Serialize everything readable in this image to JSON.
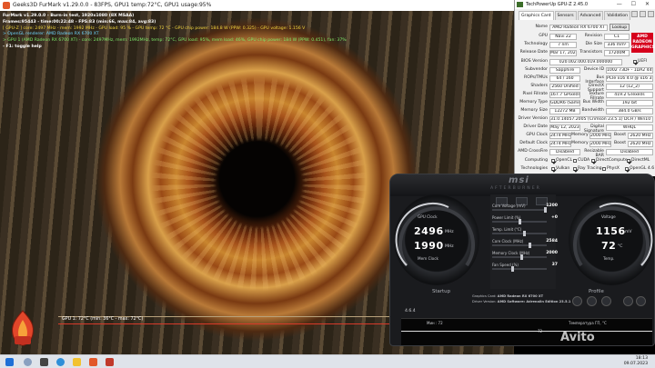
{
  "furmark": {
    "title": "Geeks3D FurMark v1.29.0.0 - 83FPS, GPU1 temp:72°C, GPU1 usage:95%",
    "info": [
      {
        "text": "FurMark v1.29.0.0 - Burn-in test, 1920x1080 (8X MSAA)",
        "style": "white"
      },
      {
        "text": "Frames:95443 - time:00:22:48 - FPS:83 (min:66, max:84, avg:83)",
        "style": "white"
      },
      {
        "text": "[ GPU-Z ] core: 2497 MHz - mem: 1992 MHz - GPU load: 95 % - GPU temp: 72 °C - GPU chip power: 184.8 W (PPW: 0.325) - GPU voltage: 1.156 V",
        "style": "yellow"
      },
      {
        "text": "> OpenGL renderer: AMD Radeon RX 6700 XT",
        "style": "cyan"
      },
      {
        "text": "> GPU 1 (AMD Radeon RX 6700 XT) - core: 2497MHz, mem: 1992MHz, temp: 72°C, GPU load: 95%, mem load: 46%, GPU chip power: 184 W (PPW: 0.451), fan: 37%",
        "style": "green"
      },
      {
        "text": "- F1: toggle help",
        "style": "white"
      }
    ],
    "graph_label": "GPU 1: 72°C (min: 36°C - max: 72°C)"
  },
  "gpuz": {
    "title": "TechPowerUp GPU-Z 2.45.0",
    "tabs": [
      "Graphics Card",
      "Sensors",
      "Advanced",
      "Validation"
    ],
    "rows": {
      "name": {
        "label": "Name",
        "value": "AMD Radeon RX 6700 XT"
      },
      "gpu": {
        "label": "GPU",
        "value": "Navi 22"
      },
      "revision": {
        "label": "Revision",
        "value": "C1"
      },
      "technology": {
        "label": "Technology",
        "value": "7 nm"
      },
      "die_size": {
        "label": "Die Size",
        "value": "336 mm²"
      },
      "release_date": {
        "label": "Release Date",
        "value": "Mar 17, 2021"
      },
      "transistors": {
        "label": "Transistors",
        "value": "17200M"
      },
      "bios_version": {
        "label": "BIOS Version",
        "value": "020.002.000.019.000000"
      },
      "subvendor": {
        "label": "Subvendor",
        "value": "Sapphire"
      },
      "device_id": {
        "label": "Device ID",
        "value": "1002 73DF - 1DA2 449E"
      },
      "rops_tmus": {
        "label": "ROPs/TMUs",
        "value": "64 / 160"
      },
      "bus_interface": {
        "label": "Bus Interface",
        "value": "PCIe x16 4.0 @ x16 3.0"
      },
      "shaders": {
        "label": "Shaders",
        "value": "2560 Unified"
      },
      "directx": {
        "label": "DirectX Support",
        "value": "12 (12_2)"
      },
      "pixel_fillrate": {
        "label": "Pixel Fillrate",
        "value": "167.7 GPixel/s"
      },
      "texture_fillrate": {
        "label": "Texture Fillrate",
        "value": "419.2 GTexel/s"
      },
      "memory_type": {
        "label": "Memory Type",
        "value": "GDDR6 (Samsung)"
      },
      "bus_width": {
        "label": "Bus Width",
        "value": "192 bit"
      },
      "memory_size": {
        "label": "Memory Size",
        "value": "12272 MB"
      },
      "bandwidth": {
        "label": "Bandwidth",
        "value": "384.0 GB/s"
      },
      "driver_version": {
        "label": "Driver Version",
        "value": "31.0.14057.2005 (Crimson 23.5.1) DCH / Win10 64"
      },
      "driver_date": {
        "label": "Driver Date",
        "value": "May 12, 2023"
      },
      "digital_signature": {
        "label": "Digital Signature",
        "value": "WHQL"
      },
      "gpu_clock": {
        "label": "GPU Clock",
        "value": "2474 MHz"
      },
      "gpu_memory": {
        "label": "Memory",
        "value": "2000 MHz"
      },
      "gpu_boost": {
        "label": "Boost",
        "value": "2620 MHz"
      },
      "default_clock": {
        "label": "Default Clock",
        "value": "2474 MHz"
      },
      "default_memory": {
        "label": "Memory",
        "value": "2000 MHz"
      },
      "default_boost": {
        "label": "Boost",
        "value": "2620 MHz"
      },
      "crossfire": {
        "label": "AMD CrossFire",
        "value": "Disabled"
      },
      "resizable_bar_label": "Resizable BAR",
      "resizable_bar": "Disabled",
      "computing_label": "Computing",
      "technologies_label": "Technologies"
    },
    "lookup_button": "Lookup",
    "uefi_label": "UEFI",
    "computing": [
      "OpenCL",
      "CUDA",
      "DirectCompute",
      "DirectML"
    ],
    "technologies": [
      "Vulkan",
      "Ray Tracing",
      "PhysX",
      "OpenGL 4.6"
    ],
    "amd_logo": "AMD RADEON GRAPHICS"
  },
  "afterburner": {
    "brand": "msi",
    "subtitle": "AFTERBURNER",
    "gpu_clock_label": "GPU Clock",
    "mem_clock_label": "Mem Clock",
    "gpu_clock_value": "2496",
    "gpu_clock_unit": "MHz",
    "mem_clock_value": "1990",
    "mem_clock_unit": "MHz",
    "voltage_label": "Voltage",
    "temp_label": "Temp.",
    "voltage_value": "1156",
    "voltage_unit": "mV",
    "temp_value": "72",
    "temp_unit": "°C",
    "sliders": [
      {
        "name": "Core Voltage (mV)",
        "value": "1200",
        "level": 1.0
      },
      {
        "name": "Power Limit (%)",
        "value": "+0",
        "level": 0.5
      },
      {
        "name": "Temp. Limit (°C)",
        "value": "",
        "level": 0.6
      },
      {
        "name": "Core Clock (MHz)",
        "value": "2584",
        "level": 0.7
      },
      {
        "name": "Memory Clock (MHz)",
        "value": "2000",
        "level": 0.55
      },
      {
        "name": "Fan Speed (%)",
        "value": "37",
        "level": 0.37
      }
    ],
    "startup_label": "Startup",
    "profile_label": "Profile",
    "graphics_card_label": "Graphics Card:",
    "graphics_card_value": "AMD Radeon RX 6700 XT",
    "driver_label": "Driver Version:",
    "driver_value": "AMD Software: Adrenalin Edition 23.5.1",
    "version": "4.6.4",
    "graph_left": "Мин : 72",
    "graph_right": "Температура ГП, °С",
    "graph_value": "72"
  },
  "taskbar": {
    "time": "18:13",
    "date": "09.07.2023"
  },
  "watermark": "Avito"
}
